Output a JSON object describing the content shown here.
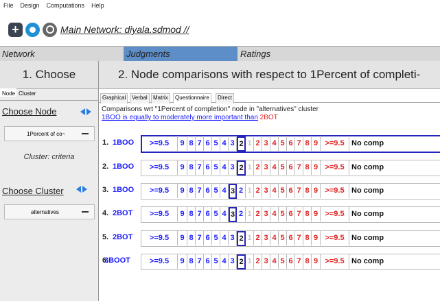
{
  "menu": [
    "File",
    "Design",
    "Computations",
    "Help"
  ],
  "toolbar": {
    "title": "Main Network: diyala.sdmod //",
    "icons": [
      "new-icon",
      "open-icon",
      "search-icon"
    ]
  },
  "top_tabs": {
    "network": "Network",
    "judgments": "Judgments",
    "ratings": "Ratings"
  },
  "left": {
    "step": "1. Choose",
    "subtabs": [
      "Node",
      "Cluster"
    ],
    "choose_node": "Choose Node",
    "node_value": "1Percent of co~",
    "cluster_text": "Cluster: criteria",
    "choose_cluster": "Choose Cluster",
    "cluster_value": "alternatives"
  },
  "right": {
    "step": "2. Node comparisons with respect to 1Percent of completi-",
    "mode_tabs": [
      "Graphical",
      "Verbal",
      "Matrix",
      "Questionnaire",
      "Direct"
    ],
    "comp_header": "Comparisons wrt \"1Percent of completion\" node in \"alternatives\" cluster",
    "verbal_blue": "1BOO is equally to moderately more important than",
    "verbal_red": "2BOT",
    "scale_left": [
      ">=9.5",
      "9",
      "8",
      "7",
      "6",
      "5",
      "4",
      "3",
      "2"
    ],
    "scale_mid": "1",
    "scale_right": [
      "2",
      "3",
      "4",
      "5",
      "6",
      "7",
      "8",
      "9",
      ">=9.5"
    ],
    "no_comp": "No comp",
    "rows": [
      {
        "num": "1.",
        "node": "1BOO",
        "sel_left": "2",
        "selected": true
      },
      {
        "num": "2.",
        "node": "1BOO",
        "sel_left": "2",
        "selected": false
      },
      {
        "num": "3.",
        "node": "1BOO",
        "sel_left": "3",
        "selected": false
      },
      {
        "num": "4.",
        "node": "2BOT",
        "sel_left": "3",
        "selected": false
      },
      {
        "num": "5.",
        "node": "2BOT",
        "sel_left": "2",
        "selected": false
      },
      {
        "num": "6.",
        "node": "3BOOT",
        "sel_left": "2",
        "selected": false
      }
    ]
  },
  "colors": {
    "accent": "#5e8ec7",
    "blue": "#1a1aff",
    "red": "#e02020"
  }
}
